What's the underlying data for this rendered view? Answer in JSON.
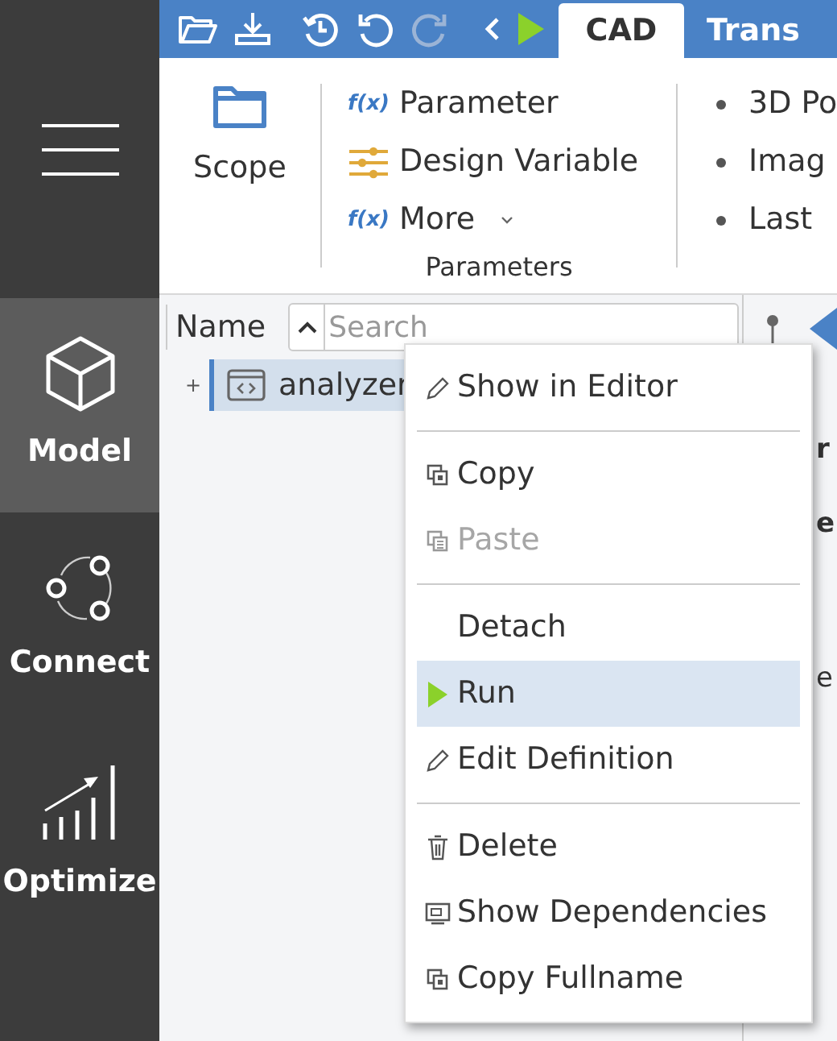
{
  "sidebar": {
    "items": [
      {
        "label": "Model",
        "selected": true
      },
      {
        "label": "Connect",
        "selected": false
      },
      {
        "label": "Optimize",
        "selected": false
      }
    ]
  },
  "ribbon_tabs": [
    {
      "label": "CAD",
      "selected": true
    },
    {
      "label": "Trans",
      "selected": false
    }
  ],
  "ribbon": {
    "scope_button": "Scope",
    "parameters_group": {
      "title": "Parameters",
      "items": [
        {
          "label": "Parameter",
          "symbol": "f(x)",
          "dropdown": false
        },
        {
          "label": "Design Variable",
          "dropdown": false
        },
        {
          "label": "More",
          "symbol": "f(x)",
          "dropdown": true
        }
      ]
    },
    "third_group": {
      "items": [
        "3D Po",
        "Imag",
        "Last"
      ]
    }
  },
  "tree": {
    "header": "Name",
    "search": {
      "placeholder": "Search"
    },
    "items": [
      {
        "label": "analyzer",
        "expander": "+",
        "selected": true
      }
    ]
  },
  "right_panel": {
    "texts": [
      "r",
      "e",
      "e"
    ]
  },
  "context_menu": {
    "items": [
      {
        "kind": "item",
        "label": "Show in Editor",
        "disabled": false,
        "selected": false
      },
      {
        "kind": "separator"
      },
      {
        "kind": "item",
        "label": "Copy",
        "disabled": false,
        "selected": false
      },
      {
        "kind": "item",
        "label": "Paste",
        "disabled": true,
        "selected": false
      },
      {
        "kind": "separator"
      },
      {
        "kind": "item",
        "label": "Detach",
        "disabled": false,
        "selected": false
      },
      {
        "kind": "item",
        "label": "Run",
        "disabled": false,
        "selected": true
      },
      {
        "kind": "item",
        "label": "Edit Definition",
        "disabled": false,
        "selected": false
      },
      {
        "kind": "separator"
      },
      {
        "kind": "item",
        "label": "Delete",
        "disabled": false,
        "selected": false
      },
      {
        "kind": "item",
        "label": "Show Dependencies",
        "disabled": false,
        "selected": false
      },
      {
        "kind": "item",
        "label": "Copy Fullname",
        "disabled": false,
        "selected": false
      }
    ]
  }
}
